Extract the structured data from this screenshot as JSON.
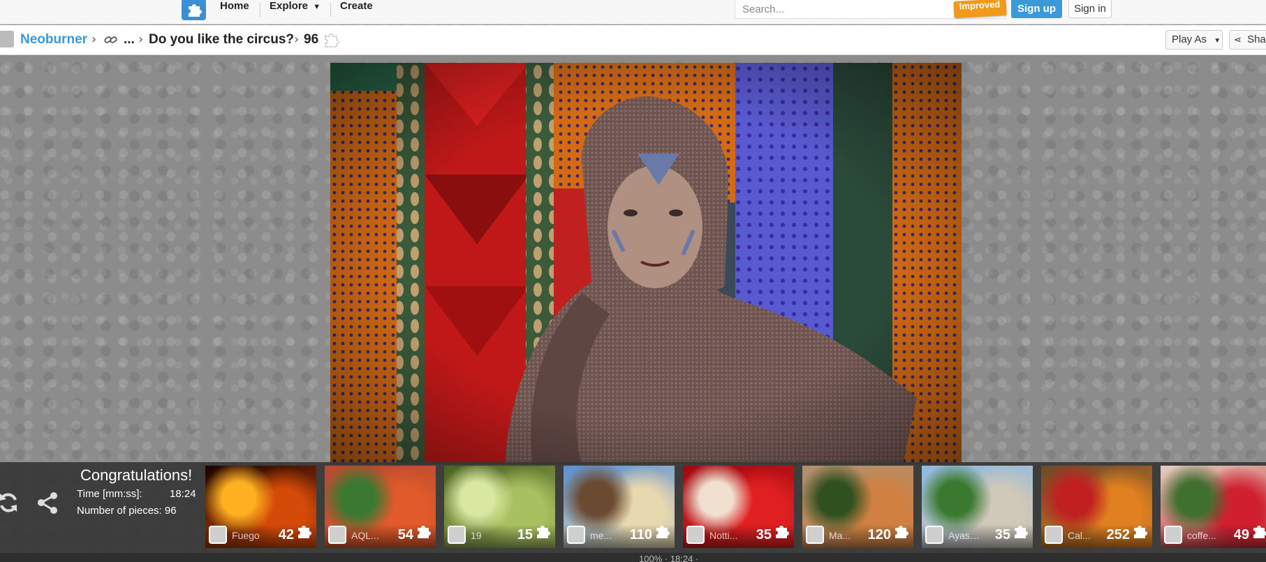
{
  "nav": {
    "home": "Home",
    "explore": "Explore",
    "create": "Create",
    "search_placeholder": "Search...",
    "improved_badge": "Improved",
    "signup": "Sign up",
    "signin": "Sign in"
  },
  "breadcrumb": {
    "user": "Neoburner",
    "ellipsis": "...",
    "title": "Do you like the circus?",
    "pieces": "96"
  },
  "actions": {
    "play_as": "Play As",
    "share": "Share"
  },
  "completion": {
    "heading": "Congratulations!",
    "time_label": "Time [mm:ss]:",
    "time_value": "18:24",
    "pieces_label": "Number of pieces: 96"
  },
  "suggestions": [
    {
      "name": "Fuego",
      "count": "42",
      "colors": [
        "#1a0400",
        "#d44a08",
        "#ffb020"
      ]
    },
    {
      "name": "AQL...",
      "count": "54",
      "colors": [
        "#b84a30",
        "#e05a2a",
        "#3a7a30"
      ]
    },
    {
      "name": "19",
      "count": "15",
      "colors": [
        "#4a6020",
        "#a8c060",
        "#d8e8a0"
      ]
    },
    {
      "name": "me...",
      "count": "110",
      "colors": [
        "#5a90d0",
        "#e8d8b0",
        "#6a4a30"
      ]
    },
    {
      "name": "Notti...",
      "count": "35",
      "colors": [
        "#a00810",
        "#e02020",
        "#f0e0d0"
      ]
    },
    {
      "name": "Ma...",
      "count": "120",
      "colors": [
        "#b09070",
        "#d08040",
        "#305020"
      ]
    },
    {
      "name": "Ayasofya",
      "count": "35",
      "colors": [
        "#90b8e0",
        "#d0c8b8",
        "#3a7a30"
      ]
    },
    {
      "name": "Cal...",
      "count": "252",
      "colors": [
        "#6a4a2a",
        "#e08020",
        "#c02020"
      ]
    },
    {
      "name": "coffe...",
      "count": "49",
      "colors": [
        "#e0d0c0",
        "#d02030",
        "#407030"
      ]
    }
  ],
  "footer": {
    "zoom_text": "100% · 18:24 ·"
  }
}
